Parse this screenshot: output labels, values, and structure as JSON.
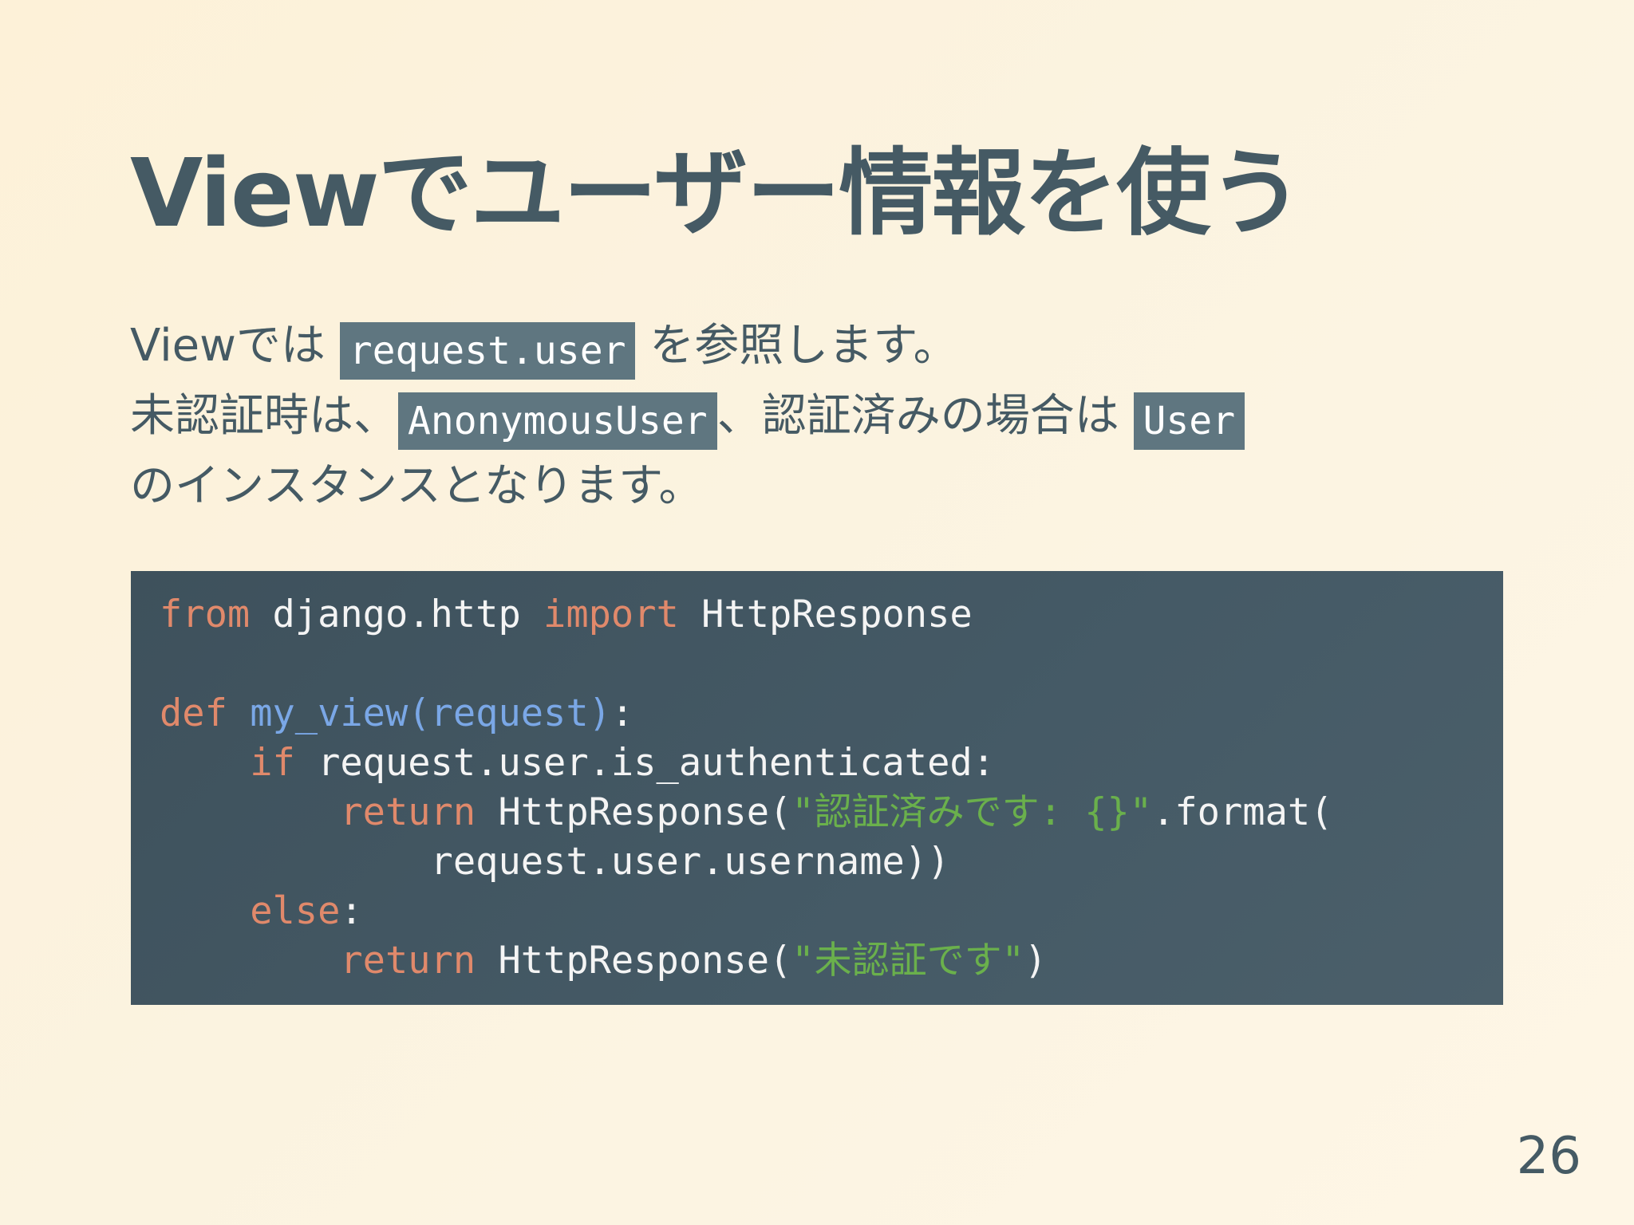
{
  "slide": {
    "title": "Viewでユーザー情報を使う",
    "body": {
      "line1": {
        "prefix": "Viewでは ",
        "code": "request.user",
        "suffix": " を参照します。"
      },
      "line2": {
        "prefix": "未認証時は、",
        "code1": "AnonymousUser",
        "middle": "、認証済みの場合は ",
        "code2": "User"
      },
      "line3": {
        "text": "のインスタンスとなります。"
      }
    },
    "code": {
      "line1": {
        "kw1": "from",
        "mod": " django.http ",
        "kw2": "import",
        "name": " HttpResponse"
      },
      "line2": "",
      "line3": {
        "kw": "def",
        "sp": " ",
        "fname": "my_view",
        "params": "(request)",
        "colon": ":"
      },
      "line4": {
        "indent": "    ",
        "kw": "if",
        "rest": " request.user.is_authenticated:"
      },
      "line5": {
        "indent": "        ",
        "kw": "return",
        "call": " HttpResponse(",
        "str": "\"認証済みです: {}\"",
        "rest": ".format("
      },
      "line6": {
        "text": "            request.user.username))"
      },
      "line7": {
        "indent": "    ",
        "kw": "else",
        "rest": ":"
      },
      "line8": {
        "indent": "        ",
        "kw": "return",
        "call": " HttpResponse(",
        "str": "\"未認証です\"",
        "rest": ")"
      }
    },
    "page_number": "26",
    "colors": {
      "text": "#455a64",
      "code_background": "#455a66",
      "keyword": "#e0896b",
      "function": "#7aa7e6",
      "string": "#6ab04c",
      "inline_code_background": "#5f7680"
    }
  }
}
